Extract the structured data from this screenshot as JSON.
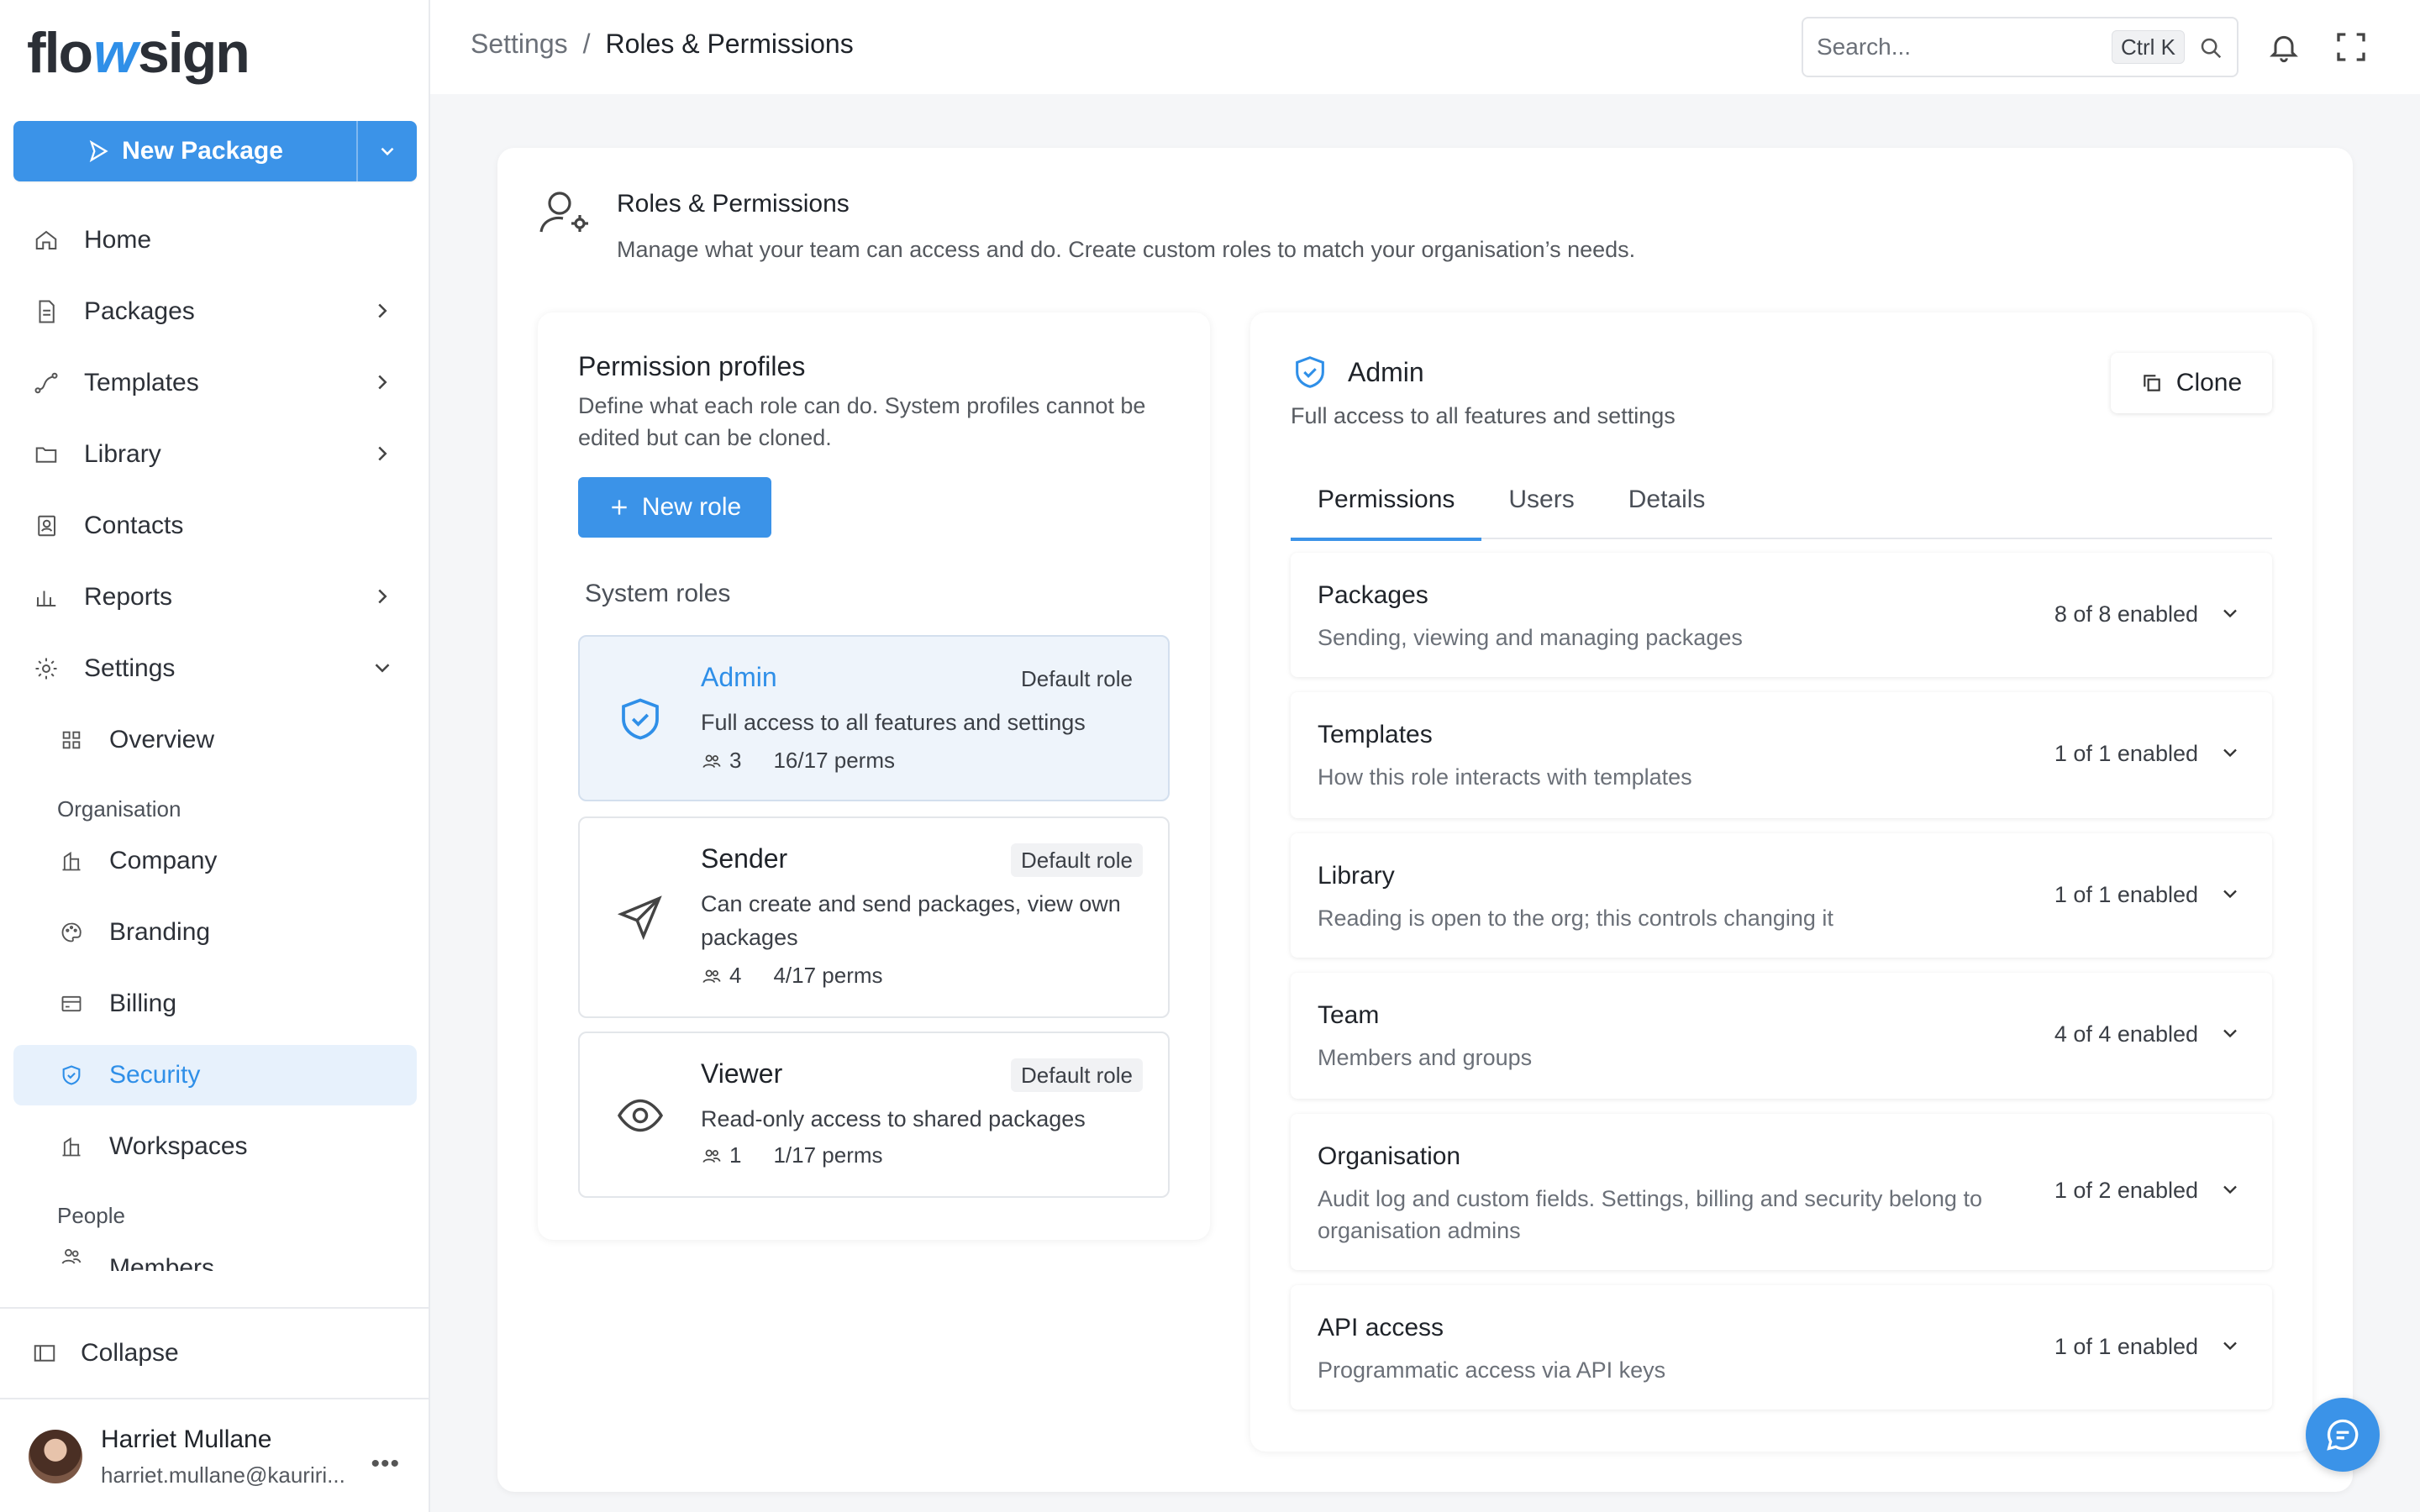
{
  "app": {
    "logo_pre": "flo",
    "logo_w": "w",
    "logo_post": "sign"
  },
  "sidebar": {
    "new_package_label": "New Package",
    "items": [
      {
        "label": "Home",
        "icon": "home-icon"
      },
      {
        "label": "Packages",
        "icon": "document-icon"
      },
      {
        "label": "Templates",
        "icon": "route-icon"
      },
      {
        "label": "Library",
        "icon": "folder-icon"
      },
      {
        "label": "Contacts",
        "icon": "contacts-icon"
      },
      {
        "label": "Reports",
        "icon": "bar-chart-icon"
      },
      {
        "label": "Settings",
        "icon": "gear-icon"
      }
    ],
    "settings_sub": {
      "overview": "Overview"
    },
    "org_label": "Organisation",
    "org_items": [
      {
        "label": "Company",
        "icon": "building-icon"
      },
      {
        "label": "Branding",
        "icon": "palette-icon"
      },
      {
        "label": "Billing",
        "icon": "credit-card-icon"
      },
      {
        "label": "Security",
        "icon": "shield-icon"
      },
      {
        "label": "Workspaces",
        "icon": "building-icon"
      }
    ],
    "people_label": "People",
    "people_items": [
      {
        "label": "Members"
      }
    ],
    "collapse_label": "Collapse",
    "user": {
      "name": "Harriet Mullane",
      "email": "harriet.mullane@kauriri..."
    }
  },
  "header": {
    "breadcrumb": [
      "Settings",
      "/",
      "Roles & Permissions"
    ],
    "search_placeholder": "Search...",
    "search_shortcut": "Ctrl K"
  },
  "page": {
    "title": "Roles & Permissions",
    "description": "Manage what your team can access and do. Create custom roles to match your organisation’s needs."
  },
  "profiles": {
    "title": "Permission profiles",
    "description": "Define what each role can do. System profiles cannot be edited but can be cloned.",
    "new_role_label": "New role",
    "system_roles_label": "System roles",
    "roles": [
      {
        "name": "Admin",
        "badge": "Default role",
        "description": "Full access to all features and settings",
        "members": "3",
        "perms": "16/17 perms"
      },
      {
        "name": "Sender",
        "badge": "Default role",
        "description": "Can create and send packages, view own packages",
        "members": "4",
        "perms": "4/17 perms"
      },
      {
        "name": "Viewer",
        "badge": "Default role",
        "description": "Read-only access to shared packages",
        "members": "1",
        "perms": "1/17 perms"
      }
    ]
  },
  "detail": {
    "title": "Admin",
    "description": "Full access to all features and settings",
    "clone_label": "Clone",
    "tabs": [
      "Permissions",
      "Users",
      "Details"
    ],
    "groups": [
      {
        "title": "Packages",
        "description": "Sending, viewing and managing packages",
        "count": "8 of 8 enabled"
      },
      {
        "title": "Templates",
        "description": "How this role interacts with templates",
        "count": "1 of 1 enabled"
      },
      {
        "title": "Library",
        "description": "Reading is open to the org; this controls changing it",
        "count": "1 of 1 enabled"
      },
      {
        "title": "Team",
        "description": "Members and groups",
        "count": "4 of 4 enabled"
      },
      {
        "title": "Organisation",
        "description": "Audit log and custom fields. Settings, billing and security belong to organisation admins",
        "count": "1 of 2 enabled"
      },
      {
        "title": "API access",
        "description": "Programmatic access via API keys",
        "count": "1 of 1 enabled"
      }
    ]
  },
  "colors": {
    "accent": "#3b93e8",
    "active_bg": "#e7f1fc"
  }
}
